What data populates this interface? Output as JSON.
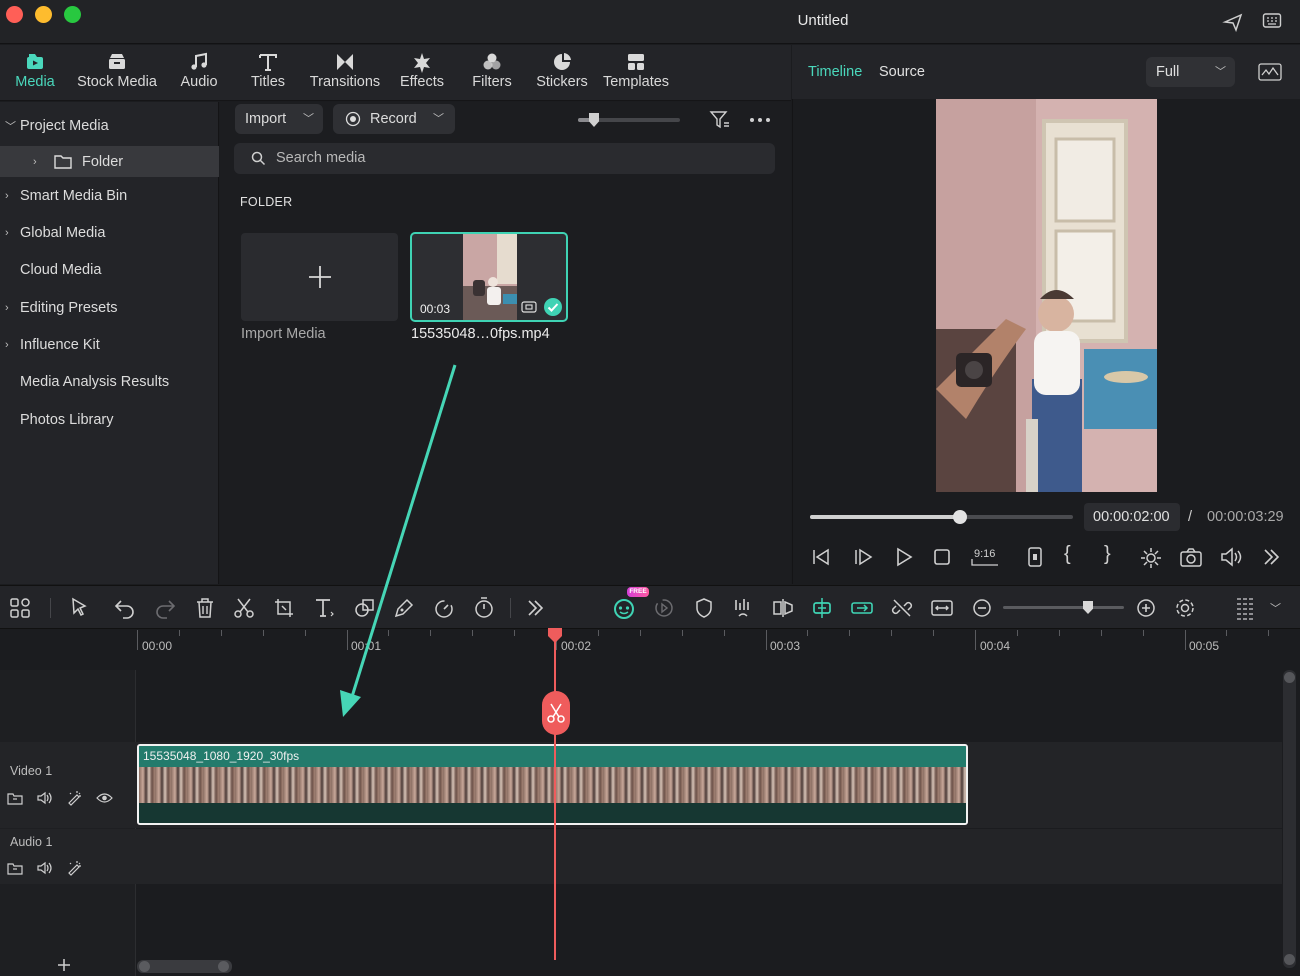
{
  "window": {
    "title": "Untitled",
    "traffic_lights": {
      "close": "#ff5f57",
      "minimize": "#febc2e",
      "zoom": "#28c840"
    }
  },
  "media_tabs": [
    {
      "label": "Media",
      "icon": "media-icon",
      "active": true
    },
    {
      "label": "Stock Media",
      "icon": "stock-media-icon"
    },
    {
      "label": "Audio",
      "icon": "music-note-icon"
    },
    {
      "label": "Titles",
      "icon": "text-t-icon"
    },
    {
      "label": "Transitions",
      "icon": "transition-bowtie-icon"
    },
    {
      "label": "Effects",
      "icon": "star-burst-icon"
    },
    {
      "label": "Filters",
      "icon": "filters-circles-icon"
    },
    {
      "label": "Stickers",
      "icon": "sticker-pie-icon"
    },
    {
      "label": "Templates",
      "icon": "templates-grid-icon"
    }
  ],
  "sidebar": {
    "items": [
      {
        "label": "Project Media",
        "chevron": "down"
      },
      {
        "label": "Folder",
        "chevron": "right",
        "selected": true,
        "icon": "folder-icon"
      },
      {
        "label": "Smart Media Bin",
        "chevron": "right"
      },
      {
        "label": "Global Media",
        "chevron": "right"
      },
      {
        "label": "Cloud Media"
      },
      {
        "label": "Editing Presets",
        "chevron": "right"
      },
      {
        "label": "Influence Kit",
        "chevron": "right"
      },
      {
        "label": "Media Analysis Results"
      },
      {
        "label": "Photos Library"
      }
    ]
  },
  "media_toolbar": {
    "import_label": "Import",
    "record_label": "Record",
    "search_placeholder": "Search media"
  },
  "media_grid": {
    "section_title": "FOLDER",
    "import_card_label": "Import Media",
    "clip": {
      "filename": "15535048…0fps.mp4",
      "duration": "00:03"
    }
  },
  "preview": {
    "tab_timeline": "Timeline",
    "tab_source": "Source",
    "quality": "Full",
    "current_time": "00:00:02:00",
    "separator": "/",
    "total_time": "00:00:03:29",
    "progress_fraction": 0.57,
    "ratio_label": "9:16"
  },
  "timeline": {
    "ruler_labels": [
      "00:00",
      "00:01",
      "00:02",
      "00:03",
      "00:04",
      "00:05"
    ],
    "tracks": {
      "video": "Video 1",
      "audio": "Audio 1"
    },
    "clip_title": "15535048_1080_1920_30fps",
    "free_badge": "FREE"
  },
  "colors": {
    "accent": "#3fd3b4",
    "playhead": "#ef5c5c",
    "clip_header": "#237b6c"
  }
}
